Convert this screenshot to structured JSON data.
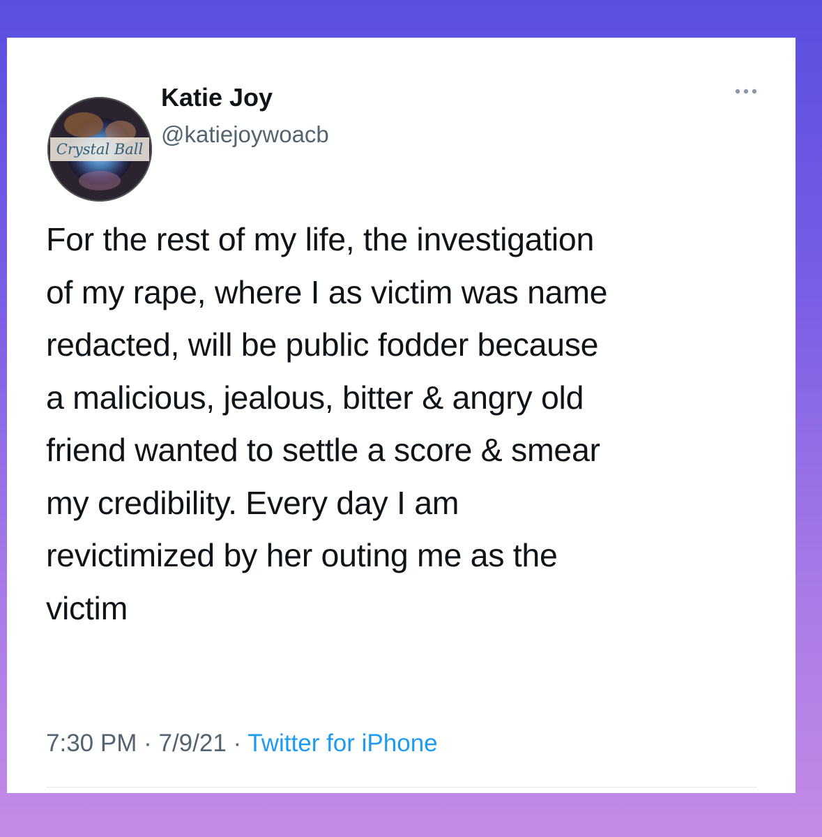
{
  "tweet": {
    "avatar": {
      "icon": "crystal-ball-logo",
      "logo_text": "Crystal Ball"
    },
    "author": {
      "display_name": "Katie Joy",
      "handle": "@katiejoywoacb"
    },
    "more_icon": "more-dots-icon",
    "text": "For the rest of my life, the investigation\nof my rape, where I as victim was name\nredacted, will be public fodder because\na malicious, jealous, bitter & angry old\nfriend wanted to settle a score & smear\nmy credibility. Every day I am\nrevictimized by her outing me as the\nvictim",
    "time": "7:30 PM",
    "separator": "·",
    "date": "7/9/21",
    "source": "Twitter for iPhone"
  },
  "colors": {
    "text_primary": "#0f1419",
    "text_secondary": "#536471",
    "link": "#1d9bf0",
    "card_background": "#ffffff",
    "page_gradient_top": "#5a4fe0",
    "page_gradient_bottom": "#c48ae6"
  }
}
